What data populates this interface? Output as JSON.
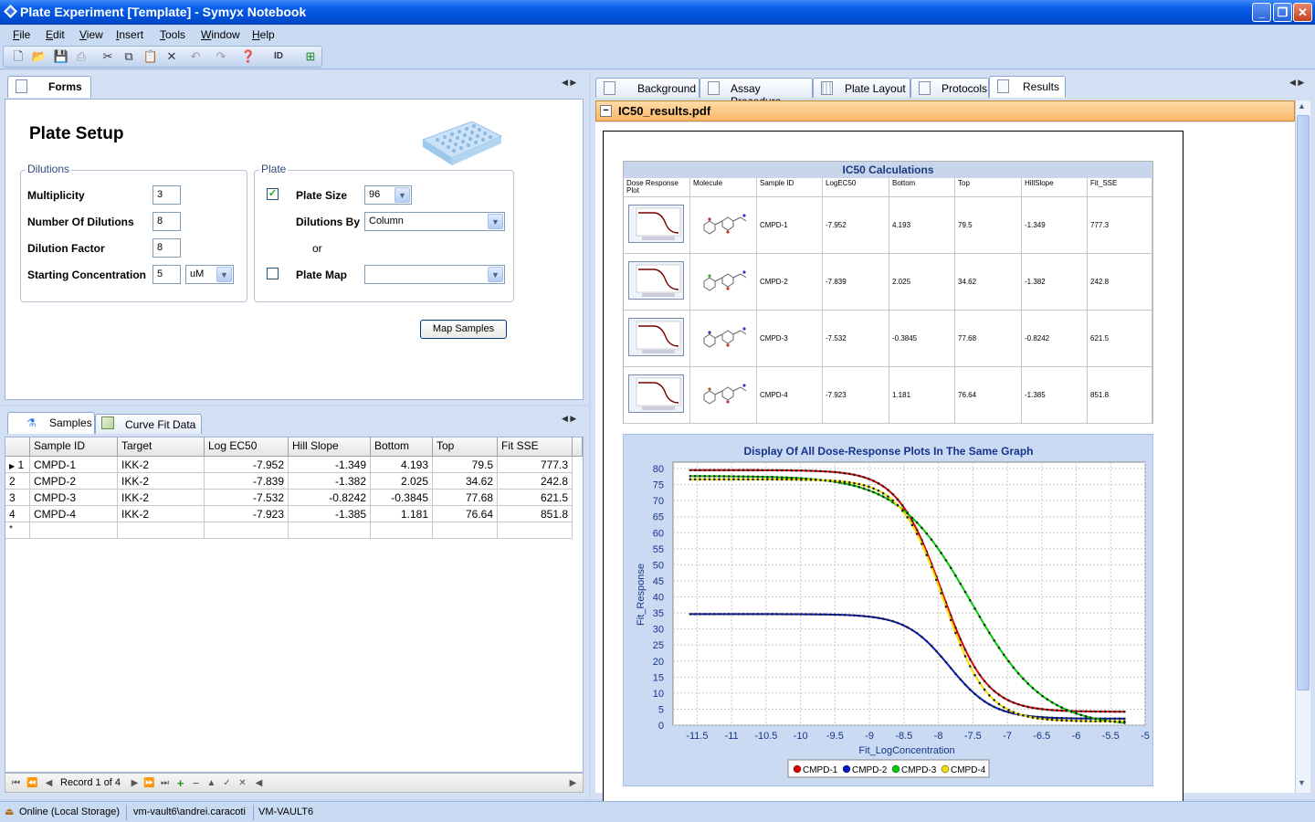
{
  "window": {
    "title": "Plate Experiment [Template] - Symyx Notebook"
  },
  "menu": [
    "File",
    "Edit",
    "View",
    "Insert",
    "Tools",
    "Window",
    "Help"
  ],
  "toolbar": {
    "icons": [
      "new-icon",
      "open-icon",
      "save-icon",
      "print-icon",
      "cut-icon",
      "copy-icon",
      "paste-icon",
      "delete-icon",
      "undo-icon",
      "redo-icon",
      "help-icon",
      "id-icon",
      "add-page-icon"
    ]
  },
  "left_top": {
    "tab": "Forms",
    "plate_setup": {
      "title": "Plate Setup",
      "dilutions": {
        "legend": "Dilutions",
        "multiplicity_label": "Multiplicity",
        "multiplicity_value": "3",
        "num_dilutions_label": "Number Of Dilutions",
        "num_dilutions_value": "8",
        "dilution_factor_label": "Dilution Factor",
        "dilution_factor_value": "8",
        "starting_conc_label": "Starting Concentration",
        "starting_conc_value": "5",
        "starting_conc_unit": "uM"
      },
      "plate": {
        "legend": "Plate",
        "plate_size_label": "Plate Size",
        "plate_size_value": "96",
        "plate_size_checked": true,
        "dilutions_by_label": "Dilutions By",
        "dilutions_by_value": "Column",
        "or_label": "or",
        "plate_map_label": "Plate Map",
        "plate_map_value": "",
        "plate_map_checked": false
      },
      "map_samples_label": "Map Samples"
    }
  },
  "left_bottom": {
    "tabs": [
      "Samples",
      "Curve Fit Data"
    ],
    "columns": [
      "Sample ID",
      "Target",
      "Log EC50",
      "Hill Slope",
      "Bottom",
      "Top",
      "Fit SSE"
    ],
    "rows": [
      {
        "n": "1",
        "sample": "CMPD-1",
        "target": "IKK-2",
        "logec50": "-7.952",
        "hill": "-1.349",
        "bottom": "4.193",
        "top": "79.5",
        "sse": "777.3"
      },
      {
        "n": "2",
        "sample": "CMPD-2",
        "target": "IKK-2",
        "logec50": "-7.839",
        "hill": "-1.382",
        "bottom": "2.025",
        "top": "34.62",
        "sse": "242.8"
      },
      {
        "n": "3",
        "sample": "CMPD-3",
        "target": "IKK-2",
        "logec50": "-7.532",
        "hill": "-0.8242",
        "bottom": "-0.3845",
        "top": "77.68",
        "sse": "621.5"
      },
      {
        "n": "4",
        "sample": "CMPD-4",
        "target": "IKK-2",
        "logec50": "-7.923",
        "hill": "-1.385",
        "bottom": "1.181",
        "top": "76.64",
        "sse": "851.8"
      }
    ],
    "new_row_marker": "*",
    "record_text": "Record 1 of 4"
  },
  "right": {
    "tabs": [
      "Background",
      "Assay Procedure",
      "Plate Layout",
      "Protocols",
      "Results"
    ],
    "active_tab": "Results",
    "results_header": "IC50_results.pdf",
    "collapse_symbol": "−",
    "ic50_table": {
      "title": "IC50 Calculations",
      "columns": [
        "Dose Response Plot",
        "Molecule",
        "Sample ID",
        "LogEC50",
        "Bottom",
        "Top",
        "HillSlope",
        "Fit_SSE"
      ],
      "rows": [
        [
          "CMPD-1",
          "-7.952",
          "4.193",
          "79.5",
          "-1.349",
          "777.3"
        ],
        [
          "CMPD-2",
          "-7.839",
          "2.025",
          "34.62",
          "-1.382",
          "242.8"
        ],
        [
          "CMPD-3",
          "-7.532",
          "-0.3845",
          "77.68",
          "-0.8242",
          "621.5"
        ],
        [
          "CMPD-4",
          "-7.923",
          "1.181",
          "76.64",
          "-1.385",
          "851.8"
        ]
      ]
    }
  },
  "chart_data": {
    "type": "line",
    "title": "Display Of All Dose-Response Plots In The Same Graph",
    "xlabel": "Fit_LogConcentration",
    "ylabel": "Fit_Response",
    "xlim": [
      -11.85,
      -5.0
    ],
    "ylim": [
      0,
      82
    ],
    "xticks": [
      -11.5,
      -11.0,
      -10.5,
      -10.0,
      -9.5,
      -9.0,
      -8.5,
      -8.0,
      -7.5,
      -7.0,
      -6.5,
      -6.0,
      -5.5,
      -5.0
    ],
    "yticks": [
      0,
      5,
      10,
      15,
      20,
      25,
      30,
      35,
      40,
      45,
      50,
      55,
      60,
      65,
      70,
      75,
      80
    ],
    "grid": true,
    "legend": "bottom",
    "x_range": [
      -11.6,
      -5.3
    ],
    "series": [
      {
        "name": "CMPD-1",
        "color": "#dd0000",
        "top": 79.5,
        "bottom": 4.193,
        "logec50": -7.952,
        "hill": -1.349
      },
      {
        "name": "CMPD-2",
        "color": "#0018c8",
        "top": 34.62,
        "bottom": 2.025,
        "logec50": -7.839,
        "hill": -1.382
      },
      {
        "name": "CMPD-3",
        "color": "#00cc00",
        "top": 77.68,
        "bottom": -0.3845,
        "logec50": -7.532,
        "hill": -0.8242
      },
      {
        "name": "CMPD-4",
        "color": "#f0e000",
        "top": 76.64,
        "bottom": 1.181,
        "logec50": -7.923,
        "hill": -1.385
      }
    ]
  },
  "status": {
    "connection": "Online (Local Storage)",
    "user": "vm-vault6\\andrei.caracoti",
    "server": "VM-VAULT6"
  }
}
